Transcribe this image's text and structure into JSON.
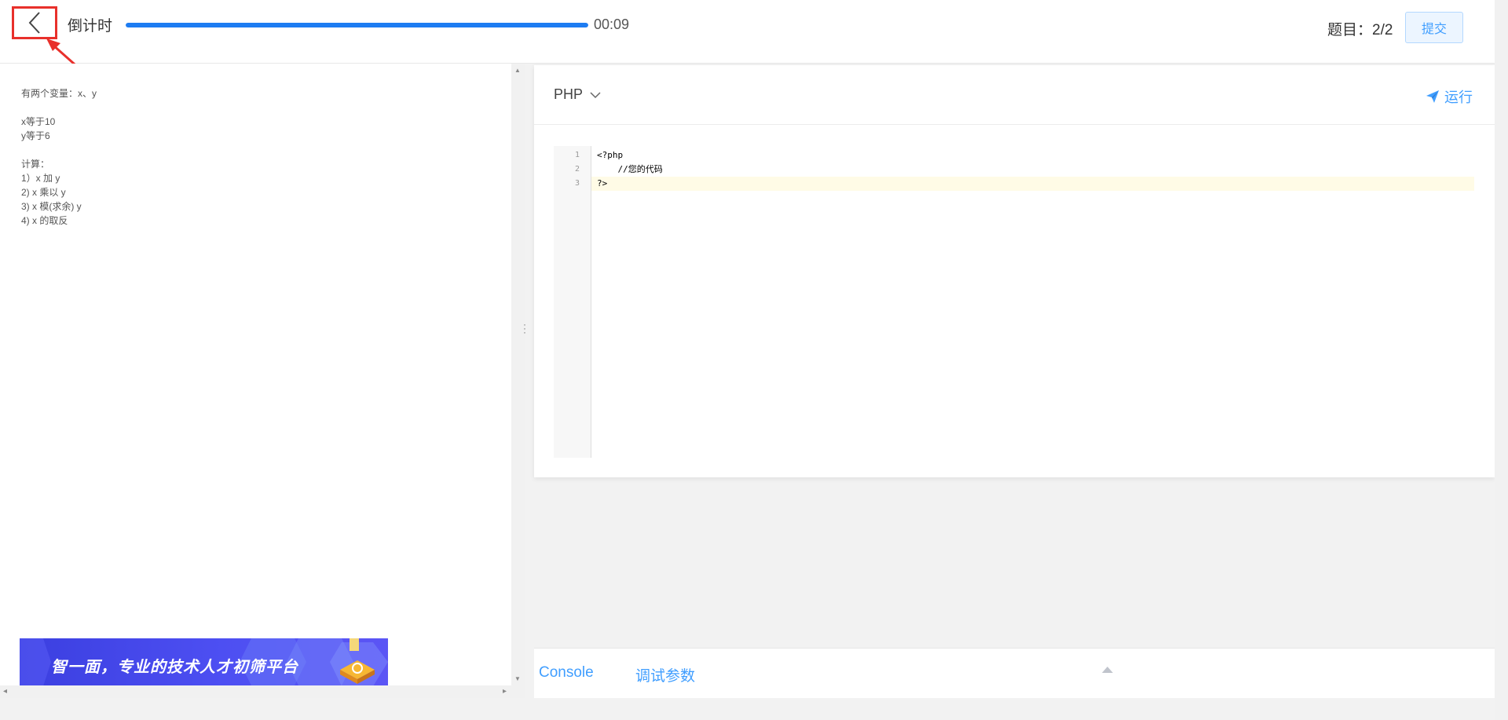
{
  "header": {
    "timer_label": "倒计时",
    "progress_fraction": 1.0,
    "time_remaining": "00:09",
    "question_count": "题目：2/2",
    "submit_label": "提交"
  },
  "problem": {
    "lines": [
      "有两个变量：x、y",
      "",
      "x等于10",
      "y等于6",
      "",
      "计算：",
      "1）x 加 y",
      "2) x 乘以 y",
      "3) x 模(求余) y",
      "4) x 的取反"
    ],
    "banner_text": "智一面，专业的技术人才初筛平台"
  },
  "editor": {
    "language": "PHP",
    "run_label": "运行",
    "line_numbers": [
      "1",
      "2",
      "3"
    ],
    "code_lines": [
      "<?php",
      "    //您的代码",
      "?>"
    ]
  },
  "console": {
    "tabs": [
      "Console",
      "调试参数"
    ]
  },
  "colors": {
    "accent": "#409eff",
    "progress": "#1d7cf2",
    "annotation": "#e8302b"
  }
}
